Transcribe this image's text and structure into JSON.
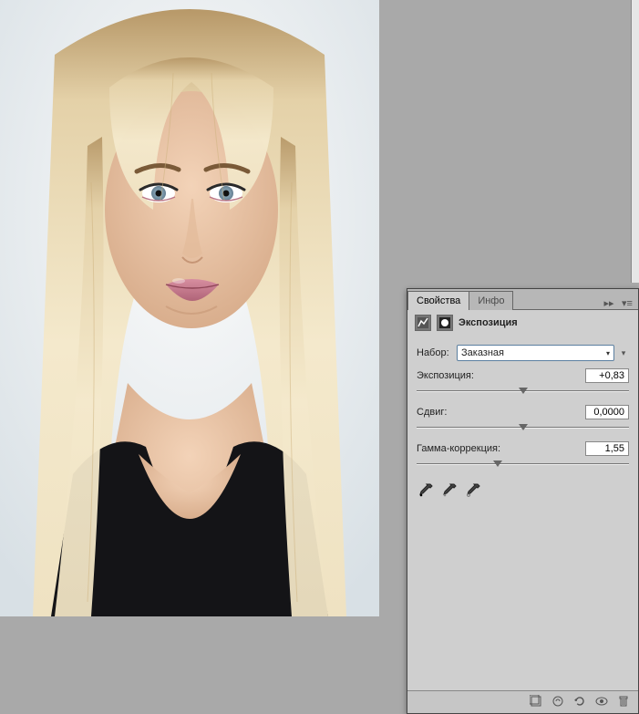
{
  "tabs": {
    "properties": "Свойства",
    "info": "Инфо"
  },
  "panel": {
    "title": "Экспозиция"
  },
  "preset": {
    "label": "Набор:",
    "value": "Заказная"
  },
  "sliders": {
    "exposure": {
      "label": "Экспозиция:",
      "value": "+0,83",
      "pos_pct": 50
    },
    "offset": {
      "label": "Сдвиг:",
      "value": "0,0000",
      "pos_pct": 50
    },
    "gamma": {
      "label": "Гамма-коррекция:",
      "value": "1,55",
      "pos_pct": 38
    }
  }
}
